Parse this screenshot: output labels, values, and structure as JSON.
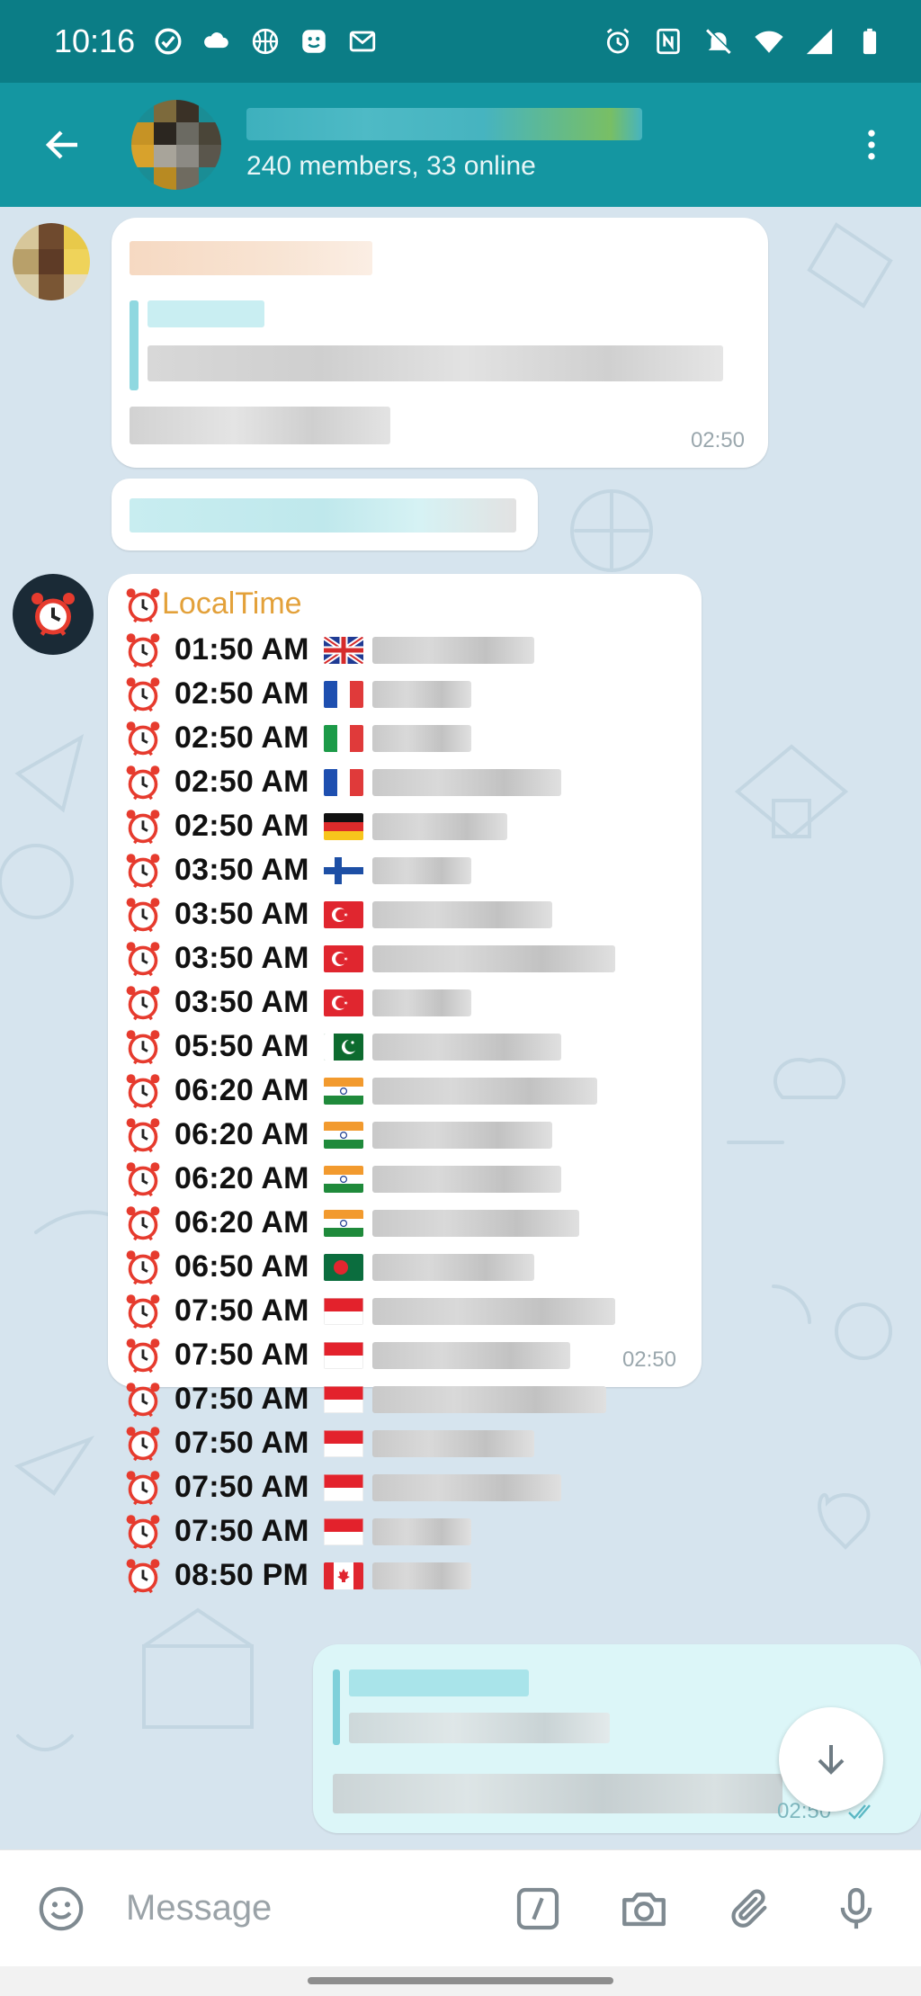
{
  "status_bar": {
    "time": "10:16",
    "left_icons": [
      "check-circle-icon",
      "cloud-icon",
      "basketball-icon",
      "smiley-icon",
      "gmail-icon"
    ],
    "right_icons": [
      "alarm-icon",
      "nfc-icon",
      "mute-icon",
      "wifi-icon",
      "cell-signal-icon",
      "battery-icon"
    ]
  },
  "header": {
    "members_text": "240 members, 33 online",
    "back_icon": "arrow-left-icon",
    "menu_icon": "more-vertical-icon"
  },
  "messages": {
    "first_time": "02:50",
    "bot": {
      "name": "LocalTime",
      "time": "02:50",
      "rows": [
        {
          "time": "01:50 AM",
          "flag": "uk"
        },
        {
          "time": "02:50 AM",
          "flag": "france"
        },
        {
          "time": "02:50 AM",
          "flag": "italy"
        },
        {
          "time": "02:50 AM",
          "flag": "france"
        },
        {
          "time": "02:50 AM",
          "flag": "germany"
        },
        {
          "time": "03:50 AM",
          "flag": "finland"
        },
        {
          "time": "03:50 AM",
          "flag": "turkey"
        },
        {
          "time": "03:50 AM",
          "flag": "turkey"
        },
        {
          "time": "03:50 AM",
          "flag": "turkey"
        },
        {
          "time": "05:50 AM",
          "flag": "pakistan"
        },
        {
          "time": "06:20 AM",
          "flag": "india"
        },
        {
          "time": "06:20 AM",
          "flag": "india"
        },
        {
          "time": "06:20 AM",
          "flag": "india"
        },
        {
          "time": "06:20 AM",
          "flag": "india"
        },
        {
          "time": "06:50 AM",
          "flag": "bangladesh"
        },
        {
          "time": "07:50 AM",
          "flag": "indonesia"
        },
        {
          "time": "07:50 AM",
          "flag": "indonesia"
        },
        {
          "time": "07:50 AM",
          "flag": "indonesia"
        },
        {
          "time": "07:50 AM",
          "flag": "indonesia"
        },
        {
          "time": "07:50 AM",
          "flag": "indonesia"
        },
        {
          "time": "07:50 AM",
          "flag": "indonesia"
        },
        {
          "time": "08:50 PM",
          "flag": "canada"
        }
      ]
    },
    "outgoing_time": "02:50"
  },
  "input_bar": {
    "placeholder": "Message",
    "icons": [
      "emoji-icon",
      "bot-command-icon",
      "camera-icon",
      "attach-icon",
      "microphone-icon"
    ]
  },
  "colors": {
    "status_bar": "#0b7d86",
    "header": "#1496a1",
    "chat_bg": "#d6e4ee",
    "bot_name": "#e3a13a",
    "outgoing_bubble": "#dcf6f8"
  }
}
